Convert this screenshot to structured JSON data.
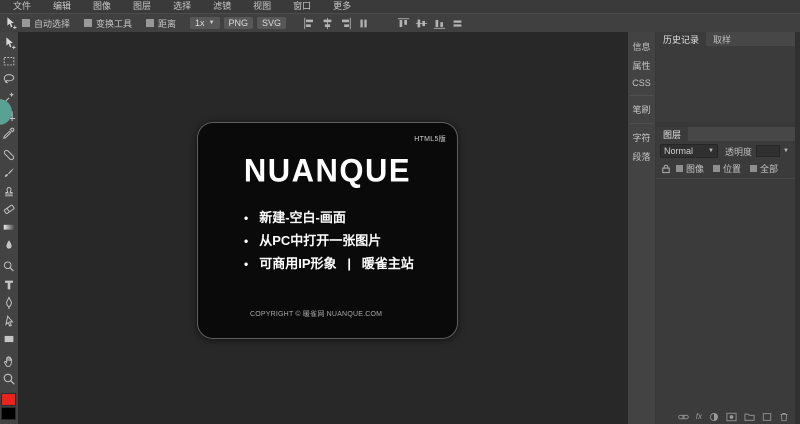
{
  "menu_bar": {
    "items": [
      "文件",
      "编辑",
      "图像",
      "图层",
      "选择",
      "滤镜",
      "视图",
      "窗口",
      "更多"
    ]
  },
  "options_bar": {
    "auto_select_label": "自动选择",
    "transform_tool_label": "变换工具",
    "distance_label": "距离",
    "zoom_select_value": "1x",
    "png_button": "PNG",
    "svg_button": "SVG",
    "align_icons": [
      "align-left-icon",
      "align-center-h-icon",
      "align-right-icon",
      "distribute-h-icon",
      "align-top-icon",
      "align-middle-icon",
      "align-bottom-icon",
      "distribute-v-icon"
    ]
  },
  "toolbox": {
    "tools": [
      "move-tool",
      "marquee-tool",
      "lasso-tool",
      "magic-wand-tool",
      "crop-tool",
      "eyedropper-tool",
      "healing-tool",
      "brush-tool",
      "clone-stamp-tool",
      "eraser-tool",
      "gradient-tool",
      "blur-tool",
      "dodge-tool",
      "type-tool",
      "pen-tool",
      "path-select-tool",
      "shape-tool",
      "hand-tool",
      "zoom-tool"
    ],
    "foreground_color": "#e8241d",
    "background_color": "#000000"
  },
  "canvas_card": {
    "badge": "HTML5版",
    "logo": "NUANQUE",
    "bullets": [
      "新建-空白-画面",
      "从PC中打开一张图片",
      "可商用IP形象   |   暖雀主站"
    ],
    "footer": "COPYRIGHT © 暖雀网 NUANQUE.COM"
  },
  "right_panel": {
    "side_tabs": [
      "信息",
      "属性",
      "CSS",
      "笔刷",
      "字符",
      "段落"
    ],
    "history_tab": "历史记录",
    "sample_tab": "取样",
    "layers": {
      "title": "图层",
      "blend_mode": "Normal",
      "opacity_label": "透明度",
      "lock_labels": [
        "图像",
        "位置",
        "全部"
      ],
      "fx_glyph": "fx",
      "bottom_icons": [
        "link-icon",
        "effects-icon",
        "adjustment-icon",
        "mask-icon",
        "folder-icon",
        "new-layer-icon",
        "delete-icon"
      ]
    }
  },
  "colors": {
    "canvas_bg": "#282828",
    "panel_bg": "#3b3b3b",
    "header_bg": "#474747",
    "card_bg": "#0a0a0a"
  }
}
